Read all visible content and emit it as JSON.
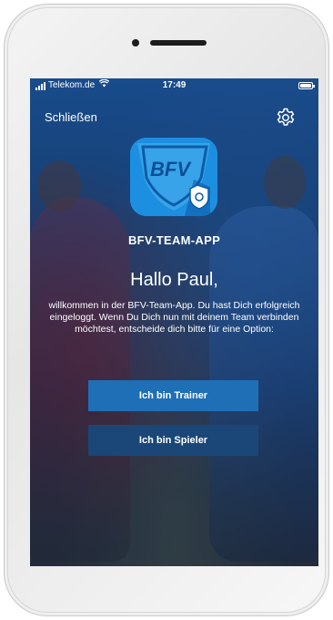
{
  "status_bar": {
    "carrier": "Telekom.de",
    "time": "17:49"
  },
  "header": {
    "close_label": "Schließen",
    "settings_icon": "gear-icon"
  },
  "app": {
    "logo_text": "BFV",
    "title": "BFV-TEAM-APP"
  },
  "content": {
    "greeting": "Hallo Paul,",
    "welcome_text": "willkommen in der BFV-Team-App. Du hast Dich erfolgreich eingeloggt. Wenn Du Dich nun mit deinem Team verbinden möchtest, entscheide dich bitte für eine Option:"
  },
  "buttons": {
    "trainer_label": "Ich bin Trainer",
    "spieler_label": "Ich bin Spieler"
  },
  "colors": {
    "trainer_button": "#1f6fb7",
    "spieler_button": "#1a4777",
    "logo_blue": "#1d8fe0"
  }
}
